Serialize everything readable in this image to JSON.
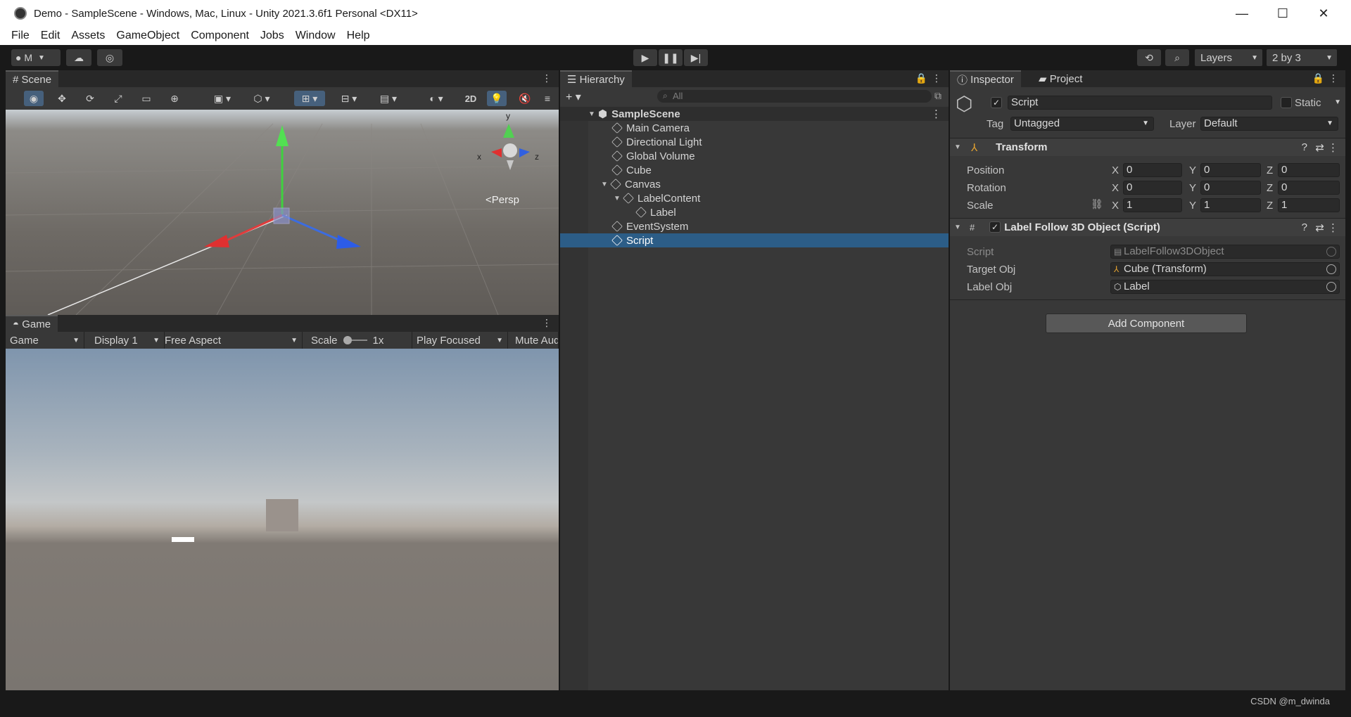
{
  "window": {
    "title": "Demo - SampleScene - Windows, Mac, Linux - Unity 2021.3.6f1 Personal <DX11>",
    "minimize": "—",
    "maximize": "☐",
    "close": "✕"
  },
  "menu": [
    "File",
    "Edit",
    "Assets",
    "GameObject",
    "Component",
    "Jobs",
    "Window",
    "Help"
  ],
  "toolbar": {
    "account": "M",
    "layers": "Layers",
    "layout": "2 by 3"
  },
  "scene": {
    "tab": "Scene",
    "btn_2d": "2D",
    "persp": "<Persp",
    "axis_x": "x",
    "axis_y": "y",
    "axis_z": "z"
  },
  "game": {
    "tab": "Game",
    "mode": "Game",
    "display": "Display 1",
    "aspect": "Free Aspect",
    "scale_label": "Scale",
    "scale_value": "1x",
    "play_mode": "Play Focused",
    "mute": "Mute Aud"
  },
  "hierarchy": {
    "tab": "Hierarchy",
    "search_placeholder": "All",
    "scene_name": "SampleScene",
    "items": [
      {
        "label": "Main Camera"
      },
      {
        "label": "Directional Light"
      },
      {
        "label": "Global Volume"
      },
      {
        "label": "Cube"
      },
      {
        "label": "Canvas"
      },
      {
        "label": "LabelContent"
      },
      {
        "label": "Label"
      },
      {
        "label": "EventSystem"
      },
      {
        "label": "Script"
      }
    ]
  },
  "inspector": {
    "tab_inspector": "Inspector",
    "tab_project": "Project",
    "object_name": "Script",
    "static_label": "Static",
    "tag_label": "Tag",
    "tag_value": "Untagged",
    "layer_label": "Layer",
    "layer_value": "Default",
    "transform": {
      "title": "Transform",
      "position_label": "Position",
      "rotation_label": "Rotation",
      "scale_label": "Scale",
      "x": "X",
      "y": "Y",
      "z": "Z",
      "position": [
        "0",
        "0",
        "0"
      ],
      "rotation": [
        "0",
        "0",
        "0"
      ],
      "scale": [
        "1",
        "1",
        "1"
      ]
    },
    "script_component": {
      "title": "Label Follow 3D Object (Script)",
      "script_label": "Script",
      "script_value": "LabelFollow3DObject",
      "target_label": "Target Obj",
      "target_value": "Cube (Transform)",
      "label_obj_label": "Label Obj",
      "label_obj_value": "Label"
    },
    "add_component": "Add Component"
  },
  "status": {
    "watermark": "CSDN @m_dwinda"
  },
  "colors": {
    "selection": "#2c5d87",
    "panel": "#383838",
    "tabbar": "#282828"
  }
}
